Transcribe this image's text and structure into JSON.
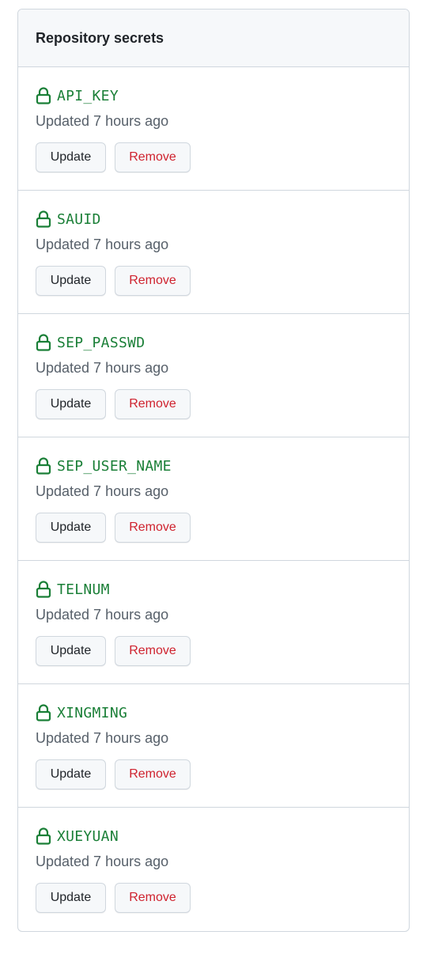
{
  "panel": {
    "title": "Repository secrets"
  },
  "secrets": [
    {
      "name": "API_KEY",
      "updated": "Updated 7 hours ago",
      "update_label": "Update",
      "remove_label": "Remove"
    },
    {
      "name": "SAUID",
      "updated": "Updated 7 hours ago",
      "update_label": "Update",
      "remove_label": "Remove"
    },
    {
      "name": "SEP_PASSWD",
      "updated": "Updated 7 hours ago",
      "update_label": "Update",
      "remove_label": "Remove"
    },
    {
      "name": "SEP_USER_NAME",
      "updated": "Updated 7 hours ago",
      "update_label": "Update",
      "remove_label": "Remove"
    },
    {
      "name": "TELNUM",
      "updated": "Updated 7 hours ago",
      "update_label": "Update",
      "remove_label": "Remove"
    },
    {
      "name": "XINGMING",
      "updated": "Updated 7 hours ago",
      "update_label": "Update",
      "remove_label": "Remove"
    },
    {
      "name": "XUEYUAN",
      "updated": "Updated 7 hours ago",
      "update_label": "Update",
      "remove_label": "Remove"
    }
  ],
  "icons": {
    "secret": "lock-icon"
  },
  "colors": {
    "secret_name": "#1a7f37",
    "remove_text": "#cf222e",
    "muted_text": "#57606a",
    "border": "#d0d7de",
    "header_bg": "#f6f8fa"
  }
}
